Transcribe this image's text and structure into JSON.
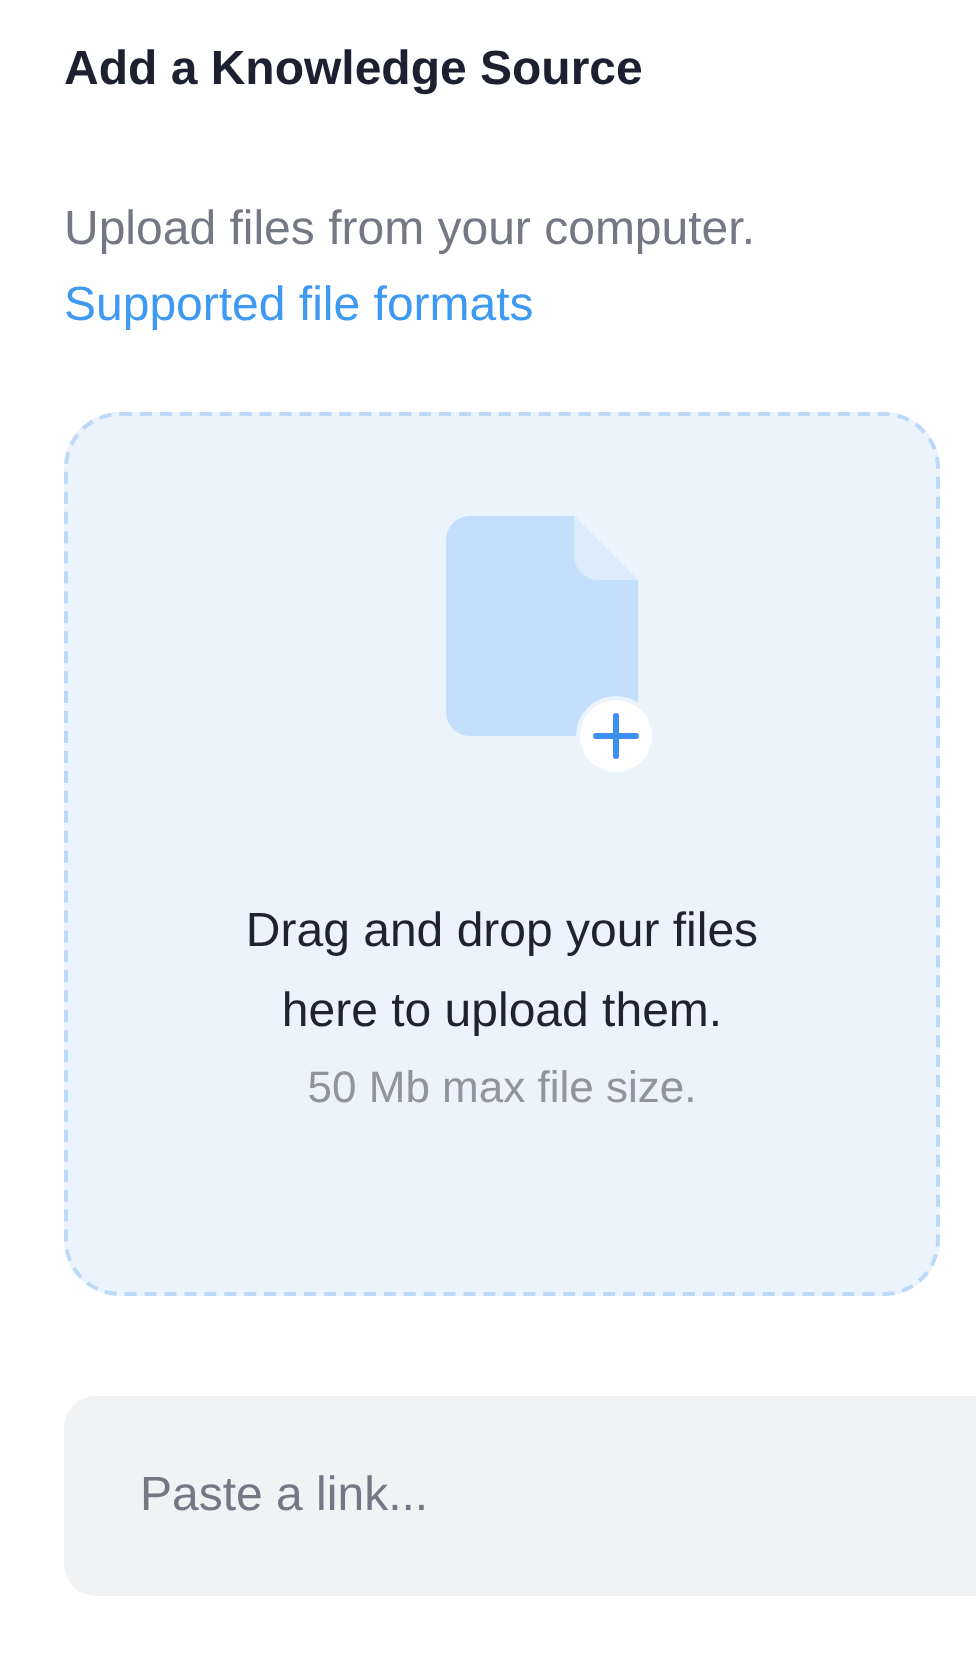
{
  "title": "Add a Knowledge Source",
  "description": "Upload files from your computer.",
  "formats_link": "Supported file formats",
  "dropzone": {
    "message": "Drag and drop your files here to upload them.",
    "limit": "50 Mb max file size."
  },
  "link_field": {
    "placeholder": "Paste a link..."
  }
}
